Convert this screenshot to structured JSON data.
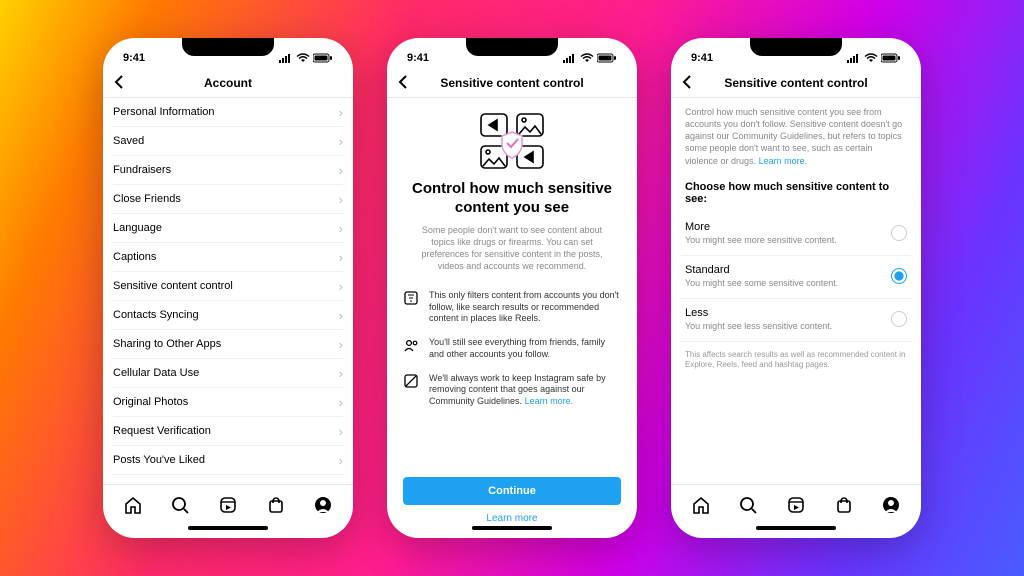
{
  "status": {
    "time": "9:41"
  },
  "phone1": {
    "title": "Account",
    "items": [
      "Personal Information",
      "Saved",
      "Fundraisers",
      "Close Friends",
      "Language",
      "Captions",
      "Sensitive content control",
      "Contacts Syncing",
      "Sharing to Other Apps",
      "Cellular Data Use",
      "Original Photos",
      "Request Verification",
      "Posts You've Liked"
    ]
  },
  "phone2": {
    "title": "Sensitive content control",
    "hero_title": "Control how much sensitive content you see",
    "hero_sub": "Some people don't want to see content about topics like drugs or firearms. You can set preferences for sensitive content in the posts, videos and accounts we recommend.",
    "bullets": [
      "This only filters content from accounts you don't follow, like search results or recommended content in places like Reels.",
      "You'll still see everything from friends, family and other accounts you follow.",
      "We'll always work to keep Instagram safe by removing content that goes against our Community Guidelines."
    ],
    "bullet3_link": "Learn more.",
    "continue_label": "Continue",
    "learn_more": "Learn more"
  },
  "phone3": {
    "title": "Sensitive content control",
    "desc": "Control how much sensitive content you see from accounts you don't follow. Sensitive content doesn't go against our Community Guidelines, but refers to topics some people don't want to see, such as certain violence or drugs.",
    "desc_link": "Learn more.",
    "choose_heading": "Choose how much sensitive content to see:",
    "options": [
      {
        "label": "More",
        "sub": "You might see more sensitive content.",
        "selected": false
      },
      {
        "label": "Standard",
        "sub": "You might see some sensitive content.",
        "selected": true
      },
      {
        "label": "Less",
        "sub": "You might see less sensitive content.",
        "selected": false
      }
    ],
    "footnote": "This affects search results as well as recommended content in Explore, Reels, feed and hashtag pages."
  },
  "tabs": [
    "home",
    "search",
    "reels",
    "shop",
    "profile"
  ]
}
